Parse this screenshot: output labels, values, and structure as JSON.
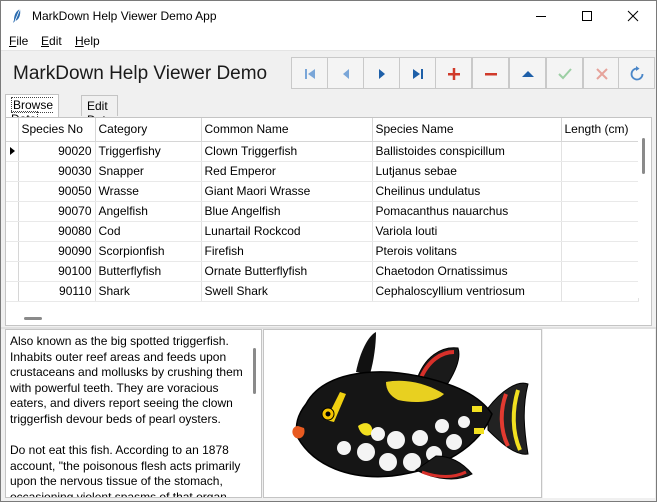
{
  "window": {
    "title": "MarkDown Help Viewer Demo App",
    "icon": "feather-icon"
  },
  "menu": [
    "File",
    "Edit",
    "Help"
  ],
  "heading": "MarkDown Help Viewer Demo",
  "navigator": [
    {
      "icon": "first-record-icon",
      "enabled": false,
      "color": "#7aa6d8"
    },
    {
      "icon": "prior-record-icon",
      "enabled": false,
      "color": "#7aa6d8"
    },
    {
      "icon": "next-record-icon",
      "enabled": true,
      "color": "#1e5fa8"
    },
    {
      "icon": "last-record-icon",
      "enabled": true,
      "color": "#1e5fa8"
    },
    {
      "icon": "insert-record-icon",
      "enabled": true,
      "color": "#d03a2a"
    },
    {
      "icon": "delete-record-icon",
      "enabled": true,
      "color": "#d03a2a"
    },
    {
      "icon": "edit-record-icon",
      "enabled": true,
      "color": "#1e5fa8"
    },
    {
      "icon": "post-record-icon",
      "enabled": false,
      "color": "#9ccfa4"
    },
    {
      "icon": "cancel-record-icon",
      "enabled": false,
      "color": "#e6a39b"
    },
    {
      "icon": "refresh-icon",
      "enabled": true,
      "color": "#4a86c8"
    }
  ],
  "tabs": [
    {
      "label": "Browse Data",
      "active": true
    },
    {
      "label": "Edit Data",
      "active": false
    }
  ],
  "grid": {
    "columns": [
      "Species No",
      "Category",
      "Common Name",
      "Species Name",
      "Length (cm)"
    ],
    "rows": [
      [
        "90020",
        "Triggerfishy",
        "Clown Triggerfish",
        "Ballistoides conspicillum",
        ""
      ],
      [
        "90030",
        "Snapper",
        "Red Emperor",
        "Lutjanus sebae",
        ""
      ],
      [
        "90050",
        "Wrasse",
        "Giant Maori Wrasse",
        "Cheilinus undulatus",
        ""
      ],
      [
        "90070",
        "Angelfish",
        "Blue Angelfish",
        "Pomacanthus nauarchus",
        ""
      ],
      [
        "90080",
        "Cod",
        "Lunartail Rockcod",
        "Variola louti",
        ""
      ],
      [
        "90090",
        "Scorpionfish",
        "Firefish",
        "Pterois volitans",
        ""
      ],
      [
        "90100",
        "Butterflyfish",
        "Ornate Butterflyfish",
        "Chaetodon Ornatissimus",
        ""
      ],
      [
        "90110",
        "Shark",
        "Swell Shark",
        "Cephaloscyllium ventriosum",
        ""
      ]
    ],
    "current_row": 0
  },
  "description": [
    "Also known as the big spotted triggerfish.  Inhabits outer reef areas and feeds upon crustaceans and mollusks by crushing them with powerful teeth.  They are voracious eaters, and divers report seeing the clown triggerfish devour beds of pearl oysters.",
    "Do not eat this fish.  According to an 1878 account, \"the poisonous flesh acts primarily upon the nervous tissue of the stomach, occasioning violent spasms of that organ."
  ],
  "image": {
    "subject": "clown-triggerfish-illustration"
  }
}
